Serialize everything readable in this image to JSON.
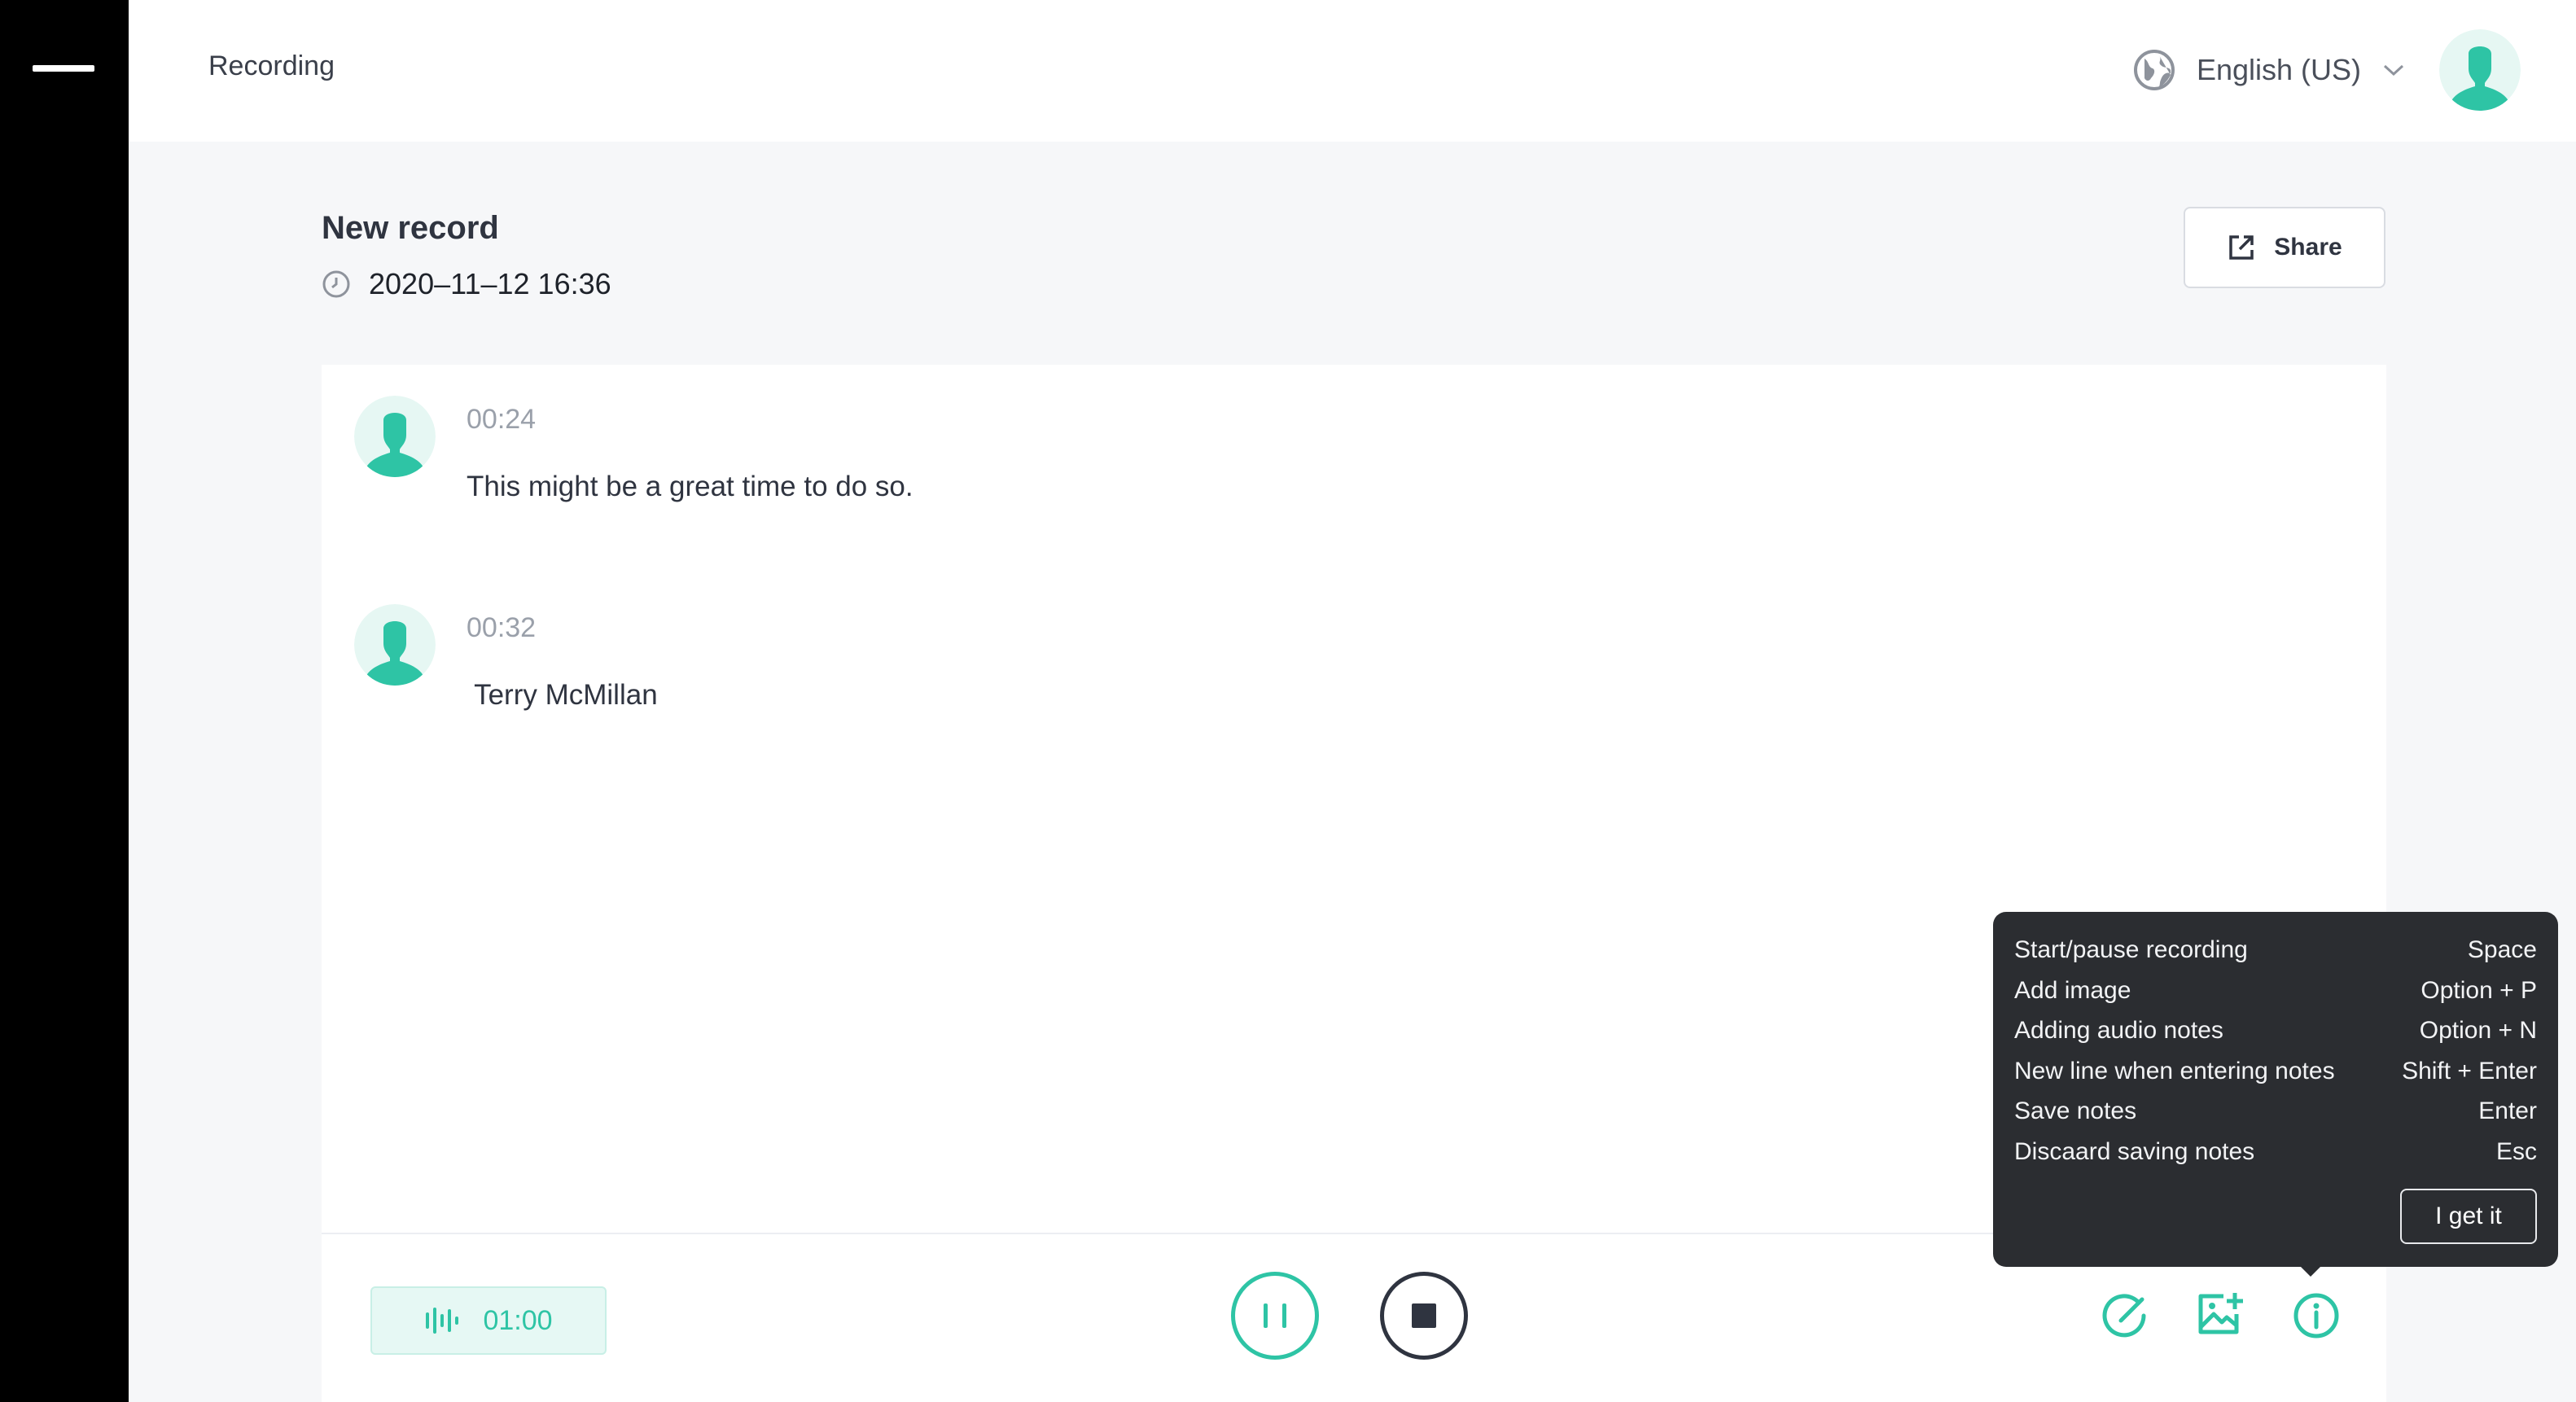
{
  "header": {
    "title": "Recording",
    "language": "English (US)"
  },
  "record": {
    "title": "New record",
    "date": "2020–11–12 16:36",
    "share_label": "Share"
  },
  "entries": [
    {
      "time": "00:24",
      "text": "This might be a great time to do so."
    },
    {
      "time": "00:32",
      "text": " Terry McMillan"
    }
  ],
  "footer": {
    "timer": "01:00"
  },
  "shortcuts": {
    "rows": [
      {
        "action": "Start/pause recording",
        "keys": "Space"
      },
      {
        "action": "Add image",
        "keys": "Option + P"
      },
      {
        "action": "Adding audio notes",
        "keys": "Option + N"
      },
      {
        "action": "New line when entering notes",
        "keys": "Shift + Enter"
      },
      {
        "action": "Save notes",
        "keys": "Enter"
      },
      {
        "action": "Discaard saving notes",
        "keys": "Esc"
      }
    ],
    "confirm_label": "I get it"
  },
  "colors": {
    "accent": "#2ec4a5",
    "sidebar": "#000000",
    "tooltip_bg": "#2b2d31"
  },
  "icons": {
    "menu": "menu-icon",
    "language": "globe-icon",
    "dropdown": "chevron-down-icon",
    "clock": "clock-icon",
    "share": "external-link-icon",
    "waveform": "waveform-icon",
    "pause": "pause-icon",
    "stop": "stop-icon",
    "edit": "edit-note-icon",
    "add_image": "add-image-icon",
    "info": "info-icon"
  }
}
